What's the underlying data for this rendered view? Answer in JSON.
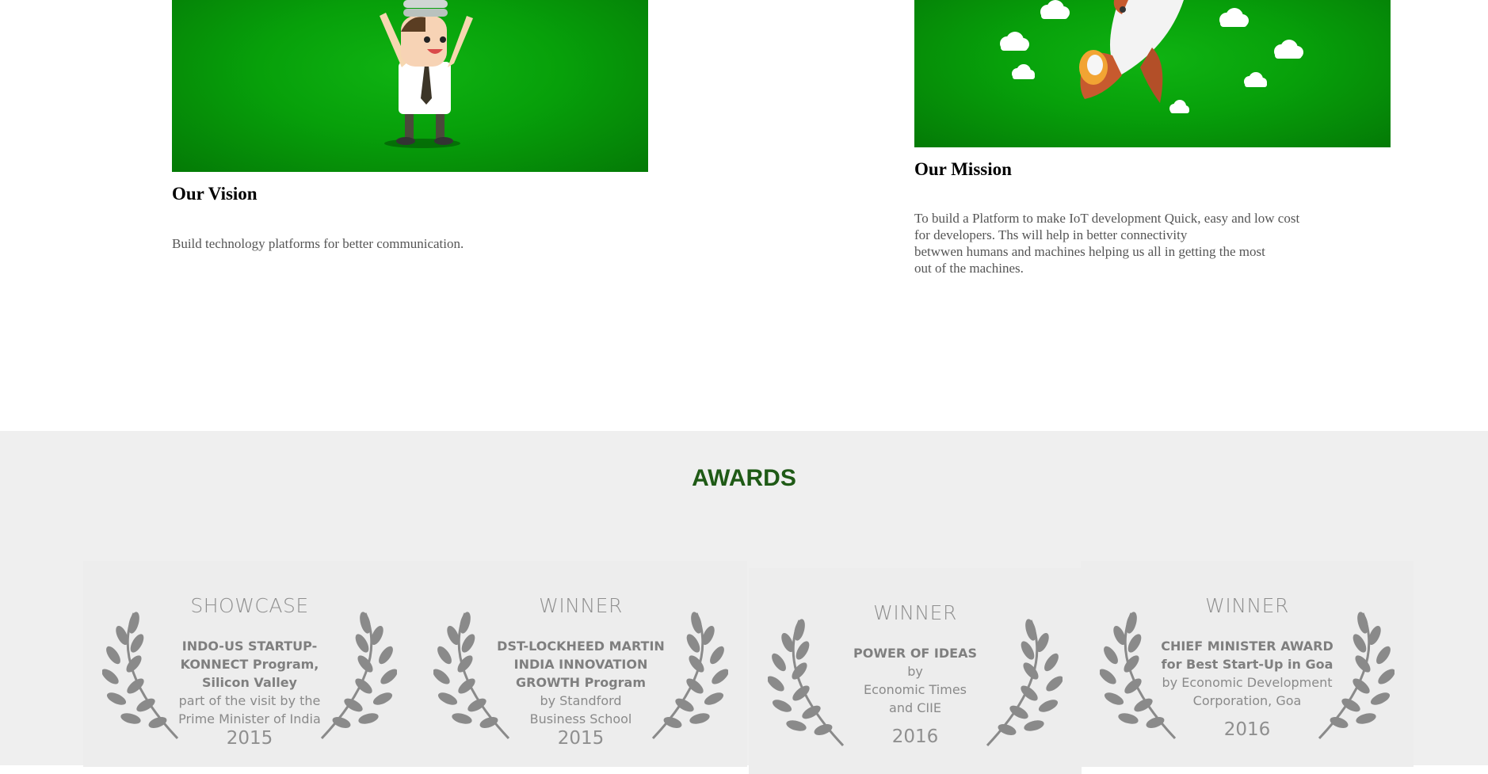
{
  "vision": {
    "title": "Our Vision",
    "text": "Build technology platforms for better communication."
  },
  "mission": {
    "title": "Our Mission",
    "lines": [
      "To build a Platform to make IoT development Quick, easy and low cost",
      "for developers. Ths will help in better connectivity",
      "betwwen humans and machines helping us all in getting the most",
      "out of the machines."
    ]
  },
  "awards": {
    "title": "AWARDS",
    "items": [
      {
        "kind": "SHOWCASE",
        "bold_lines": [
          "INDO-US STARTUP-",
          "KONNECT Program,",
          "Silicon Valley"
        ],
        "reg_lines": [
          "part of the visit by the",
          "Prime Minister of India"
        ],
        "year": "2015"
      },
      {
        "kind": "WINNER",
        "bold_lines": [
          "DST-LOCKHEED MARTIN",
          "INDIA INNOVATION",
          "GROWTH Program"
        ],
        "reg_lines": [
          "by Standford",
          "Business School"
        ],
        "year": "2015"
      },
      {
        "kind": "WINNER",
        "bold_lines": [
          "POWER OF IDEAS"
        ],
        "reg_lines": [
          "by",
          "Economic Times",
          "and CIIE"
        ],
        "year": "2016"
      },
      {
        "kind": "WINNER",
        "bold_lines": [
          "CHIEF MINISTER AWARD",
          "for Best Start-Up in Goa"
        ],
        "reg_lines": [
          "by Economic Development",
          "Corporation, Goa"
        ],
        "year": "2016"
      }
    ]
  },
  "colors": {
    "hero_green": "#07a00a",
    "awards_bg": "#efefef",
    "awards_title": "#1f5a16",
    "laurel_gray": "#8a8a8a"
  }
}
